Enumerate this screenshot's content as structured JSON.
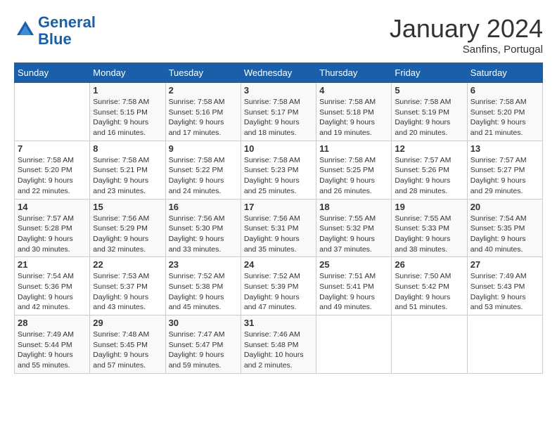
{
  "header": {
    "logo_line1": "General",
    "logo_line2": "Blue",
    "month": "January 2024",
    "location": "Sanfins, Portugal"
  },
  "weekdays": [
    "Sunday",
    "Monday",
    "Tuesday",
    "Wednesday",
    "Thursday",
    "Friday",
    "Saturday"
  ],
  "weeks": [
    [
      {
        "day": "",
        "info": ""
      },
      {
        "day": "1",
        "info": "Sunrise: 7:58 AM\nSunset: 5:15 PM\nDaylight: 9 hours\nand 16 minutes."
      },
      {
        "day": "2",
        "info": "Sunrise: 7:58 AM\nSunset: 5:16 PM\nDaylight: 9 hours\nand 17 minutes."
      },
      {
        "day": "3",
        "info": "Sunrise: 7:58 AM\nSunset: 5:17 PM\nDaylight: 9 hours\nand 18 minutes."
      },
      {
        "day": "4",
        "info": "Sunrise: 7:58 AM\nSunset: 5:18 PM\nDaylight: 9 hours\nand 19 minutes."
      },
      {
        "day": "5",
        "info": "Sunrise: 7:58 AM\nSunset: 5:19 PM\nDaylight: 9 hours\nand 20 minutes."
      },
      {
        "day": "6",
        "info": "Sunrise: 7:58 AM\nSunset: 5:20 PM\nDaylight: 9 hours\nand 21 minutes."
      }
    ],
    [
      {
        "day": "7",
        "info": "Sunrise: 7:58 AM\nSunset: 5:20 PM\nDaylight: 9 hours\nand 22 minutes."
      },
      {
        "day": "8",
        "info": "Sunrise: 7:58 AM\nSunset: 5:21 PM\nDaylight: 9 hours\nand 23 minutes."
      },
      {
        "day": "9",
        "info": "Sunrise: 7:58 AM\nSunset: 5:22 PM\nDaylight: 9 hours\nand 24 minutes."
      },
      {
        "day": "10",
        "info": "Sunrise: 7:58 AM\nSunset: 5:23 PM\nDaylight: 9 hours\nand 25 minutes."
      },
      {
        "day": "11",
        "info": "Sunrise: 7:58 AM\nSunset: 5:25 PM\nDaylight: 9 hours\nand 26 minutes."
      },
      {
        "day": "12",
        "info": "Sunrise: 7:57 AM\nSunset: 5:26 PM\nDaylight: 9 hours\nand 28 minutes."
      },
      {
        "day": "13",
        "info": "Sunrise: 7:57 AM\nSunset: 5:27 PM\nDaylight: 9 hours\nand 29 minutes."
      }
    ],
    [
      {
        "day": "14",
        "info": "Sunrise: 7:57 AM\nSunset: 5:28 PM\nDaylight: 9 hours\nand 30 minutes."
      },
      {
        "day": "15",
        "info": "Sunrise: 7:56 AM\nSunset: 5:29 PM\nDaylight: 9 hours\nand 32 minutes."
      },
      {
        "day": "16",
        "info": "Sunrise: 7:56 AM\nSunset: 5:30 PM\nDaylight: 9 hours\nand 33 minutes."
      },
      {
        "day": "17",
        "info": "Sunrise: 7:56 AM\nSunset: 5:31 PM\nDaylight: 9 hours\nand 35 minutes."
      },
      {
        "day": "18",
        "info": "Sunrise: 7:55 AM\nSunset: 5:32 PM\nDaylight: 9 hours\nand 37 minutes."
      },
      {
        "day": "19",
        "info": "Sunrise: 7:55 AM\nSunset: 5:33 PM\nDaylight: 9 hours\nand 38 minutes."
      },
      {
        "day": "20",
        "info": "Sunrise: 7:54 AM\nSunset: 5:35 PM\nDaylight: 9 hours\nand 40 minutes."
      }
    ],
    [
      {
        "day": "21",
        "info": "Sunrise: 7:54 AM\nSunset: 5:36 PM\nDaylight: 9 hours\nand 42 minutes."
      },
      {
        "day": "22",
        "info": "Sunrise: 7:53 AM\nSunset: 5:37 PM\nDaylight: 9 hours\nand 43 minutes."
      },
      {
        "day": "23",
        "info": "Sunrise: 7:52 AM\nSunset: 5:38 PM\nDaylight: 9 hours\nand 45 minutes."
      },
      {
        "day": "24",
        "info": "Sunrise: 7:52 AM\nSunset: 5:39 PM\nDaylight: 9 hours\nand 47 minutes."
      },
      {
        "day": "25",
        "info": "Sunrise: 7:51 AM\nSunset: 5:41 PM\nDaylight: 9 hours\nand 49 minutes."
      },
      {
        "day": "26",
        "info": "Sunrise: 7:50 AM\nSunset: 5:42 PM\nDaylight: 9 hours\nand 51 minutes."
      },
      {
        "day": "27",
        "info": "Sunrise: 7:49 AM\nSunset: 5:43 PM\nDaylight: 9 hours\nand 53 minutes."
      }
    ],
    [
      {
        "day": "28",
        "info": "Sunrise: 7:49 AM\nSunset: 5:44 PM\nDaylight: 9 hours\nand 55 minutes."
      },
      {
        "day": "29",
        "info": "Sunrise: 7:48 AM\nSunset: 5:45 PM\nDaylight: 9 hours\nand 57 minutes."
      },
      {
        "day": "30",
        "info": "Sunrise: 7:47 AM\nSunset: 5:47 PM\nDaylight: 9 hours\nand 59 minutes."
      },
      {
        "day": "31",
        "info": "Sunrise: 7:46 AM\nSunset: 5:48 PM\nDaylight: 10 hours\nand 2 minutes."
      },
      {
        "day": "",
        "info": ""
      },
      {
        "day": "",
        "info": ""
      },
      {
        "day": "",
        "info": ""
      }
    ]
  ]
}
